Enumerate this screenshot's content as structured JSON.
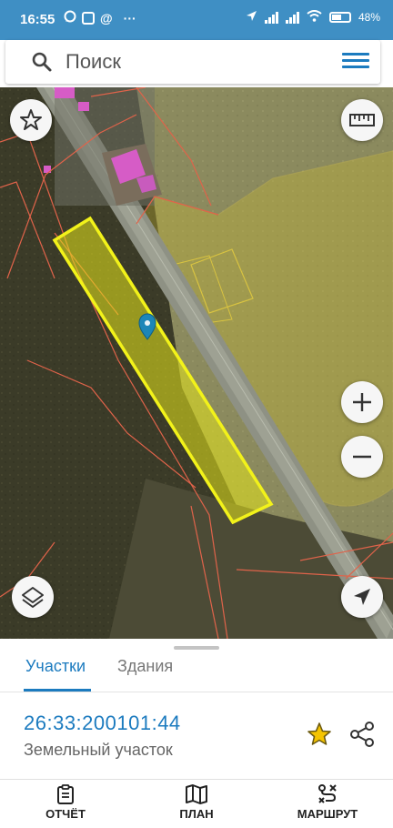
{
  "status_bar": {
    "time": "16:55",
    "battery": "48%",
    "icons": [
      "whatsapp-icon",
      "app-icon",
      "at-sign-icon",
      "more-icon",
      "location-arrow-icon",
      "signal-icon",
      "wifi-icon",
      "battery-icon"
    ],
    "more_glyph": "···",
    "at_glyph": "@"
  },
  "search": {
    "placeholder": "Поиск",
    "icon": "search-icon",
    "menu_icon": "hamburger-menu-icon"
  },
  "map": {
    "buttons": [
      "star-icon",
      "ruler-icon",
      "zoom-in-icon",
      "zoom-out-icon",
      "layers-icon",
      "locate-icon"
    ],
    "selected_parcel_color": "#e6e619",
    "boundary_color": "#e0634a",
    "marker_color": "#1c86b8"
  },
  "tabs": [
    {
      "label": "Участки",
      "active": true
    },
    {
      "label": "Здания",
      "active": false
    }
  ],
  "parcel": {
    "cadastral_number": "26:33:200101:44",
    "type": "Земельный участок"
  },
  "nav": [
    {
      "label": "ОТЧЁТ",
      "icon": "report-icon"
    },
    {
      "label": "ПЛАН",
      "icon": "map-icon"
    },
    {
      "label": "МАРШРУТ",
      "icon": "route-icon"
    }
  ],
  "colors": {
    "accent": "#1c7bbf",
    "status_bar": "#3f8fc4",
    "favorite_star": "#f2c200"
  }
}
